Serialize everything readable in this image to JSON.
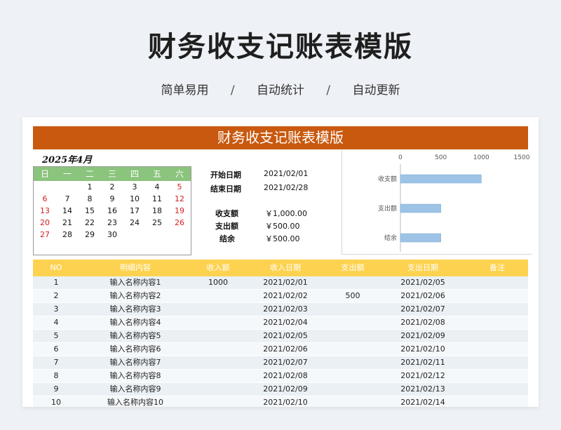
{
  "header": {
    "title": "财务收支记账表模版",
    "features": [
      "简单易用",
      "自动统计",
      "自动更新"
    ],
    "separator": "/"
  },
  "sheet": {
    "banner": "财务收支记账表模版",
    "calendar": {
      "title": "2025年4月",
      "weekdays": [
        "日",
        "一",
        "二",
        "三",
        "四",
        "五",
        "六"
      ],
      "weeks": [
        [
          "",
          "",
          "1",
          "2",
          "3",
          "4",
          "5"
        ],
        [
          "6",
          "7",
          "8",
          "9",
          "10",
          "11",
          "12"
        ],
        [
          "13",
          "14",
          "15",
          "16",
          "17",
          "18",
          "19"
        ],
        [
          "20",
          "21",
          "22",
          "23",
          "24",
          "25",
          "26"
        ],
        [
          "27",
          "28",
          "29",
          "30",
          "",
          "",
          ""
        ]
      ]
    },
    "summary": {
      "start_label": "开始日期",
      "start_value": "2021/02/01",
      "end_label": "结束日期",
      "end_value": "2021/02/28",
      "income_label": "收支额",
      "income_value": "￥1,000.00",
      "expense_label": "支出额",
      "expense_value": "￥500.00",
      "balance_label": "结余",
      "balance_value": "￥500.00"
    },
    "table": {
      "headers": [
        "NO",
        "明细内容",
        "收入额",
        "收入日期",
        "支出额",
        "支出日期",
        "备注"
      ],
      "rows": [
        [
          "1",
          "输入名称内容1",
          "1000",
          "2021/02/01",
          "",
          "2021/02/05",
          ""
        ],
        [
          "2",
          "输入名称内容2",
          "",
          "2021/02/02",
          "500",
          "2021/02/06",
          ""
        ],
        [
          "3",
          "输入名称内容3",
          "",
          "2021/02/03",
          "",
          "2021/02/07",
          ""
        ],
        [
          "4",
          "输入名称内容4",
          "",
          "2021/02/04",
          "",
          "2021/02/08",
          ""
        ],
        [
          "5",
          "输入名称内容5",
          "",
          "2021/02/05",
          "",
          "2021/02/09",
          ""
        ],
        [
          "6",
          "输入名称内容6",
          "",
          "2021/02/06",
          "",
          "2021/02/10",
          ""
        ],
        [
          "7",
          "输入名称内容7",
          "",
          "2021/02/07",
          "",
          "2021/02/11",
          ""
        ],
        [
          "8",
          "输入名称内容8",
          "",
          "2021/02/08",
          "",
          "2021/02/12",
          ""
        ],
        [
          "9",
          "输入名称内容9",
          "",
          "2021/02/09",
          "",
          "2021/02/13",
          ""
        ],
        [
          "10",
          "输入名称内容10",
          "",
          "2021/02/10",
          "",
          "2021/02/14",
          ""
        ]
      ]
    }
  },
  "colors": {
    "banner": "#c8590f",
    "calendar_header": "#8bc47c",
    "table_header": "#fdd250",
    "bar": "#9dc3e6",
    "weekend_red": "#d42020"
  },
  "chart_data": {
    "type": "bar",
    "orientation": "horizontal",
    "categories": [
      "收支额",
      "支出额",
      "结余"
    ],
    "values": [
      1000,
      500,
      500
    ],
    "xlim": [
      0,
      1500
    ],
    "xticks": [
      "0",
      "500",
      "1000",
      "1500"
    ],
    "axis_position": "top",
    "grid": false
  }
}
